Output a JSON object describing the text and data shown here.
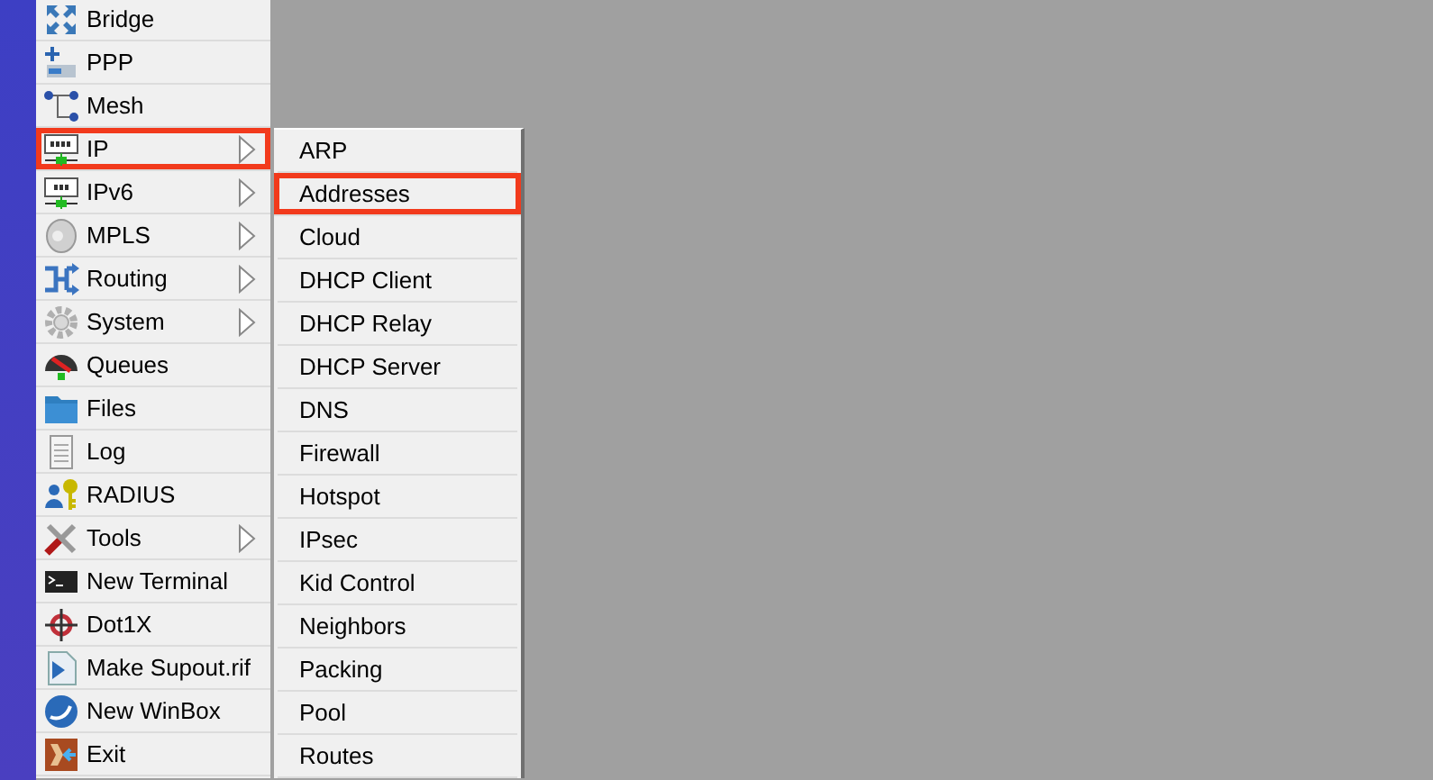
{
  "main_menu": {
    "items": [
      {
        "label": "Bridge",
        "has_submenu": false,
        "highlighted": false
      },
      {
        "label": "PPP",
        "has_submenu": false,
        "highlighted": false
      },
      {
        "label": "Mesh",
        "has_submenu": false,
        "highlighted": false
      },
      {
        "label": "IP",
        "has_submenu": true,
        "highlighted": true
      },
      {
        "label": "IPv6",
        "has_submenu": true,
        "highlighted": false
      },
      {
        "label": "MPLS",
        "has_submenu": true,
        "highlighted": false
      },
      {
        "label": "Routing",
        "has_submenu": true,
        "highlighted": false
      },
      {
        "label": "System",
        "has_submenu": true,
        "highlighted": false
      },
      {
        "label": "Queues",
        "has_submenu": false,
        "highlighted": false
      },
      {
        "label": "Files",
        "has_submenu": false,
        "highlighted": false
      },
      {
        "label": "Log",
        "has_submenu": false,
        "highlighted": false
      },
      {
        "label": "RADIUS",
        "has_submenu": false,
        "highlighted": false
      },
      {
        "label": "Tools",
        "has_submenu": true,
        "highlighted": false
      },
      {
        "label": "New Terminal",
        "has_submenu": false,
        "highlighted": false
      },
      {
        "label": "Dot1X",
        "has_submenu": false,
        "highlighted": false
      },
      {
        "label": "Make Supout.rif",
        "has_submenu": false,
        "highlighted": false
      },
      {
        "label": "New WinBox",
        "has_submenu": false,
        "highlighted": false
      },
      {
        "label": "Exit",
        "has_submenu": false,
        "highlighted": false
      }
    ]
  },
  "submenu": {
    "items": [
      {
        "label": "ARP",
        "highlighted": false
      },
      {
        "label": "Addresses",
        "highlighted": true
      },
      {
        "label": "Cloud",
        "highlighted": false
      },
      {
        "label": "DHCP Client",
        "highlighted": false
      },
      {
        "label": "DHCP Relay",
        "highlighted": false
      },
      {
        "label": "DHCP Server",
        "highlighted": false
      },
      {
        "label": "DNS",
        "highlighted": false
      },
      {
        "label": "Firewall",
        "highlighted": false
      },
      {
        "label": "Hotspot",
        "highlighted": false
      },
      {
        "label": "IPsec",
        "highlighted": false
      },
      {
        "label": "Kid Control",
        "highlighted": false
      },
      {
        "label": "Neighbors",
        "highlighted": false
      },
      {
        "label": "Packing",
        "highlighted": false
      },
      {
        "label": "Pool",
        "highlighted": false
      },
      {
        "label": "Routes",
        "highlighted": false
      }
    ]
  }
}
